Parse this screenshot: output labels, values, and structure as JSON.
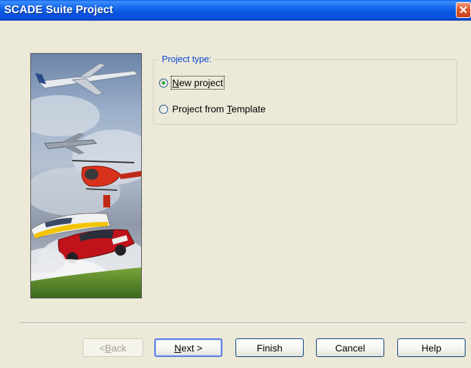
{
  "window": {
    "title": "SCADE Suite Project",
    "close_glyph": "✕"
  },
  "group": {
    "legend": "Project type:",
    "options": [
      {
        "prefix": "",
        "accel": "N",
        "suffix": "ew project",
        "selected": true
      },
      {
        "prefix": "Project from ",
        "accel": "T",
        "suffix": "emplate",
        "selected": false
      }
    ]
  },
  "buttons": {
    "back": {
      "prefix": "< ",
      "accel": "B",
      "suffix": "ack"
    },
    "next": {
      "prefix": "",
      "accel": "N",
      "suffix": "ext >"
    },
    "finish": "Finish",
    "cancel": "Cancel",
    "help": "Help"
  },
  "banner": {
    "icons": [
      "airplane-image",
      "fighter-jet-image",
      "helicopter-image",
      "train-image",
      "car-image"
    ]
  }
}
